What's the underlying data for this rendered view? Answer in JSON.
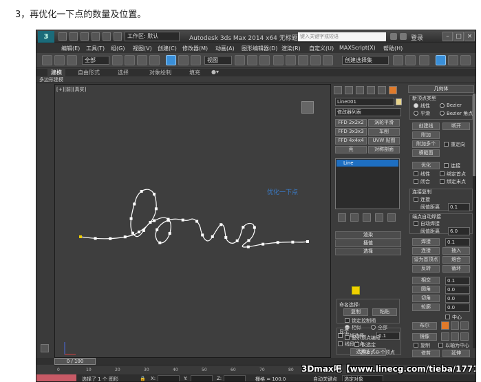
{
  "intro": "3，再优化一下点的数量及位置。",
  "titlebar": {
    "logo": "3",
    "workspace": "工作区: 默认",
    "app_title": "Autodesk 3ds Max  2014 x64     无标题",
    "search_placeholder": "键入关键字或短语",
    "login": "登录"
  },
  "menu": [
    "编辑(E)",
    "工具(T)",
    "组(G)",
    "视图(V)",
    "创建(C)",
    "修改器(M)",
    "动画(A)",
    "图形编辑器(D)",
    "渲染(R)",
    "自定义(U)",
    "MAXScript(X)",
    "帮助(H)"
  ],
  "toolbar": {
    "filter": "全部",
    "ref_coord": "视图",
    "selection_set": "创建选择集"
  },
  "ribbon": {
    "tabs": [
      "建模",
      "自由形式",
      "选择",
      "对象绘制",
      "填充"
    ],
    "active": "建模",
    "sub": "多边形建模"
  },
  "viewport": {
    "label": "[+][前][真实]",
    "note": "优化一下点",
    "curve_color": "#ffffff",
    "vertex_color": "#ffffff",
    "first_vertex_color": "#f0d000"
  },
  "cmd": {
    "object_name": "Line001",
    "modifier_list": "修改器列表",
    "mod_buttons": [
      "FFD 2x2x2",
      "涡轮平滑",
      "FFD 3x3x3",
      "车削",
      "FFD 4x4x4",
      "UVW 贴图",
      "壳",
      "对称剖面"
    ],
    "stack_item": "Line",
    "rollouts": {
      "render": "渲染",
      "interp": "插值",
      "select": "选择"
    },
    "named_sel": "命名选择:",
    "copy": "复制",
    "paste": "粘贴",
    "lock_handles": "锁定控制柄",
    "similar": "相似",
    "all": "全部",
    "area_select": "区域选择:",
    "area_val": "0.1",
    "segment_end": "线段端点",
    "select_by": "选择方式...",
    "display": "显示",
    "show_vertex_num": "显示顶点编号",
    "only_selected": "仅选定",
    "selected_count": "选择了 0 个顶点"
  },
  "right": {
    "geometry": "几何体",
    "new_vertex_type": "新顶点类型",
    "linear": "线性",
    "bezier": "Bezier",
    "smooth": "平滑",
    "bezier_corner": "Bezier 角点",
    "create_line": "创建线",
    "break": "断开",
    "attach": "附加",
    "attach_multi": "附加多个",
    "reorient": "重定向",
    "cross_section": "横截面",
    "refine": "优化",
    "connect": "连接",
    "linear2": "线性",
    "bind_first": "绑定首点",
    "closed": "闭合",
    "bind_last": "绑定末点",
    "connect_copy": "连接复制",
    "connect_chk": "连接",
    "threshold": "阈值距离",
    "threshold_val": "0.1",
    "auto_weld": "端点自动焊接",
    "auto_weld_chk": "自动焊接",
    "weld_threshold": "阈值距离",
    "weld_val": "6.0",
    "weld": "焊接",
    "weld_num": "0.1",
    "connect_btn": "连接",
    "insert": "插入",
    "make_first": "设为首顶点",
    "fuse": "熔合",
    "reverse": "反转",
    "cycle": "循环",
    "crossinsert": "相交",
    "cross_val": "0.1",
    "fillet": "圆角",
    "fillet_val": "0.0",
    "chamfer": "切角",
    "chamfer_val": "0.0",
    "outline": "轮廓",
    "outline_val": "0.0",
    "center": "中心",
    "boolean": "布尔",
    "mirror": "镜像",
    "copy": "复制",
    "about_pivot": "以轴为中心",
    "trim": "修剪",
    "extend": "延伸"
  },
  "timeline": {
    "frame": "0 / 100",
    "ticks": [
      "0",
      "10",
      "20",
      "30",
      "40",
      "50",
      "60",
      "70",
      "80",
      "90"
    ]
  },
  "status": {
    "selected": "选择了 1 个 图形",
    "x": "X:",
    "y": "Y:",
    "z": "Z:",
    "grid": "栅格 = 100.0",
    "auto_key": "自动关键点",
    "set_key": "选定对象"
  },
  "watermark": "3Dmax吧【www.linecg.com/tieba/1771】"
}
